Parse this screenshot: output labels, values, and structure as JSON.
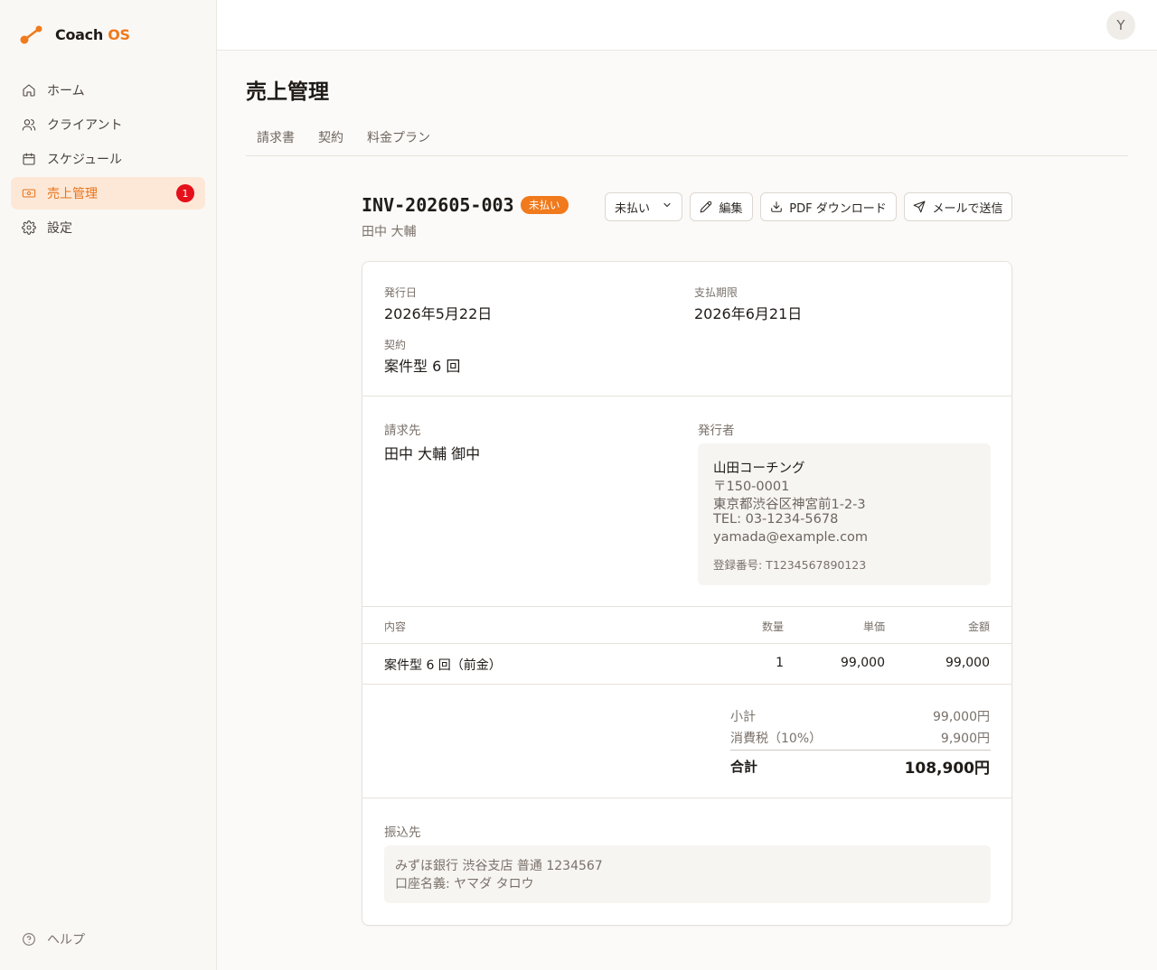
{
  "app": {
    "logo_text": "Coach",
    "logo_accent": "OS",
    "brand_color": "#f07a1c"
  },
  "sidebar": {
    "items": [
      {
        "label": "ホーム",
        "icon": "home-icon"
      },
      {
        "label": "クライアント",
        "icon": "users-icon"
      },
      {
        "label": "スケジュール",
        "icon": "calendar-icon"
      },
      {
        "label": "売上管理",
        "icon": "banknote-icon",
        "active": true,
        "badge": "1"
      },
      {
        "label": "設定",
        "icon": "gear-icon"
      }
    ],
    "help_label": "ヘルプ"
  },
  "topbar": {
    "avatar_initial": "Y"
  },
  "page": {
    "title": "売上管理",
    "tabs": [
      "請求書",
      "契約",
      "料金プラン"
    ]
  },
  "invoice": {
    "number": "INV-202605-003",
    "status": "未払い",
    "client": "田中 大輔",
    "status_select_value": "未払い",
    "actions": {
      "edit": "編集",
      "pdf": "PDF ダウンロード",
      "mail": "メールで送信"
    },
    "issue_date_label": "発行日",
    "issue_date": "2026年5月22日",
    "due_date_label": "支払期限",
    "due_date": "2026年6月21日",
    "contract_label": "契約",
    "contract": "案件型 6 回",
    "bill_to_label": "請求先",
    "bill_to": "田中 大輔 御中",
    "issuer_label": "発行者",
    "issuer": {
      "name": "山田コーチング",
      "postal": "〒150-0001",
      "address": "東京都渋谷区神宮前1-2-3",
      "tel": "TEL: 03-1234-5678",
      "email": "yamada@example.com",
      "registration": "登録番号: T1234567890123"
    },
    "table": {
      "headers": {
        "item": "内容",
        "qty": "数量",
        "unit_price": "単価",
        "amount": "金額"
      },
      "rows": [
        {
          "item": "案件型 6 回（前金）",
          "qty": "1",
          "unit_price": "99,000",
          "amount": "99,000"
        }
      ]
    },
    "summary": {
      "subtotal_label": "小計",
      "subtotal": "99,000円",
      "tax_label": "消費税（10%）",
      "tax": "9,900円",
      "total_label": "合計",
      "total": "108,900円"
    },
    "bank_label": "振込先",
    "bank": {
      "line1": "みずほ銀行 渋谷支店 普通 1234567",
      "line2": "口座名義: ヤマダ タロウ"
    }
  }
}
